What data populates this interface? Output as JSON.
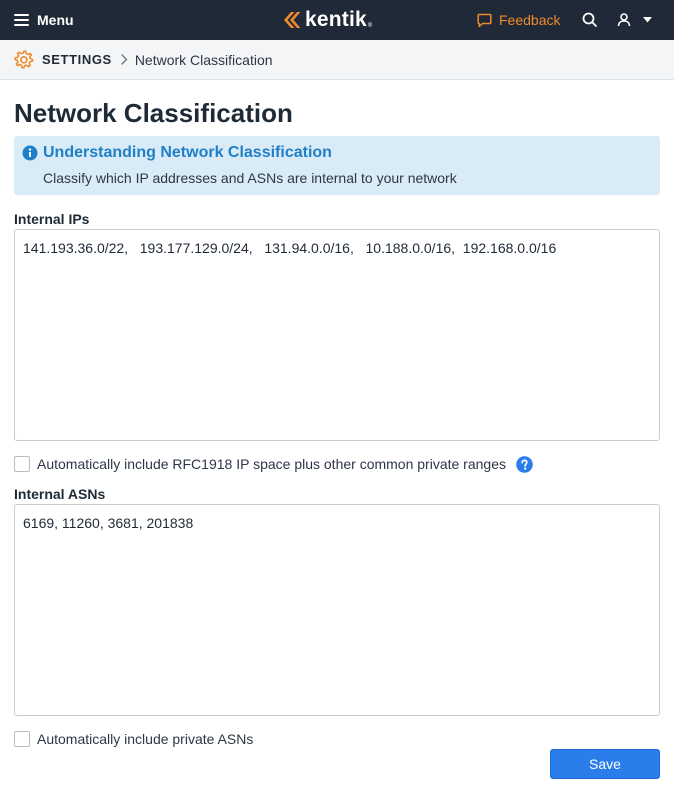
{
  "topbar": {
    "menu_label": "Menu",
    "menu_icon": "hamburger-icon",
    "logo_text": "kentik",
    "logo_mark": "®",
    "feedback_label": "Feedback",
    "feedback_icon": "speech-bubble-icon",
    "search_icon": "search-icon",
    "user_icon": "user-icon",
    "user_caret_icon": "caret-down-icon",
    "brand_color": "#f08a2b",
    "background_color": "#1f2937"
  },
  "breadcrumb": {
    "root_label": "SETTINGS",
    "root_icon": "gear-icon",
    "separator_icon": "chevron-right-icon",
    "current_label": "Network Classification"
  },
  "page": {
    "title": "Network Classification"
  },
  "callout": {
    "icon": "info-icon",
    "heading": "Understanding Network Classification",
    "body": "Classify which IP addresses and ASNs are internal to your network",
    "accent_color": "#1f7fc7",
    "background_color": "#d9ebf7"
  },
  "internal_ips": {
    "label": "Internal IPs",
    "value": "141.193.36.0/22,   193.177.129.0/24,   131.94.0.0/16,   10.188.0.0/16,  192.168.0.0/16"
  },
  "rfc1918_option": {
    "label": "Automatically include RFC1918 IP space plus other common private ranges",
    "checked": false,
    "help_icon": "question-circle-icon"
  },
  "internal_asns": {
    "label": "Internal ASNs",
    "value": "6169, 11260, 3681, 201838"
  },
  "private_asn_option": {
    "label": "Automatically include private ASNs",
    "checked": false
  },
  "actions": {
    "save_label": "Save",
    "save_color": "#2b7de9"
  }
}
